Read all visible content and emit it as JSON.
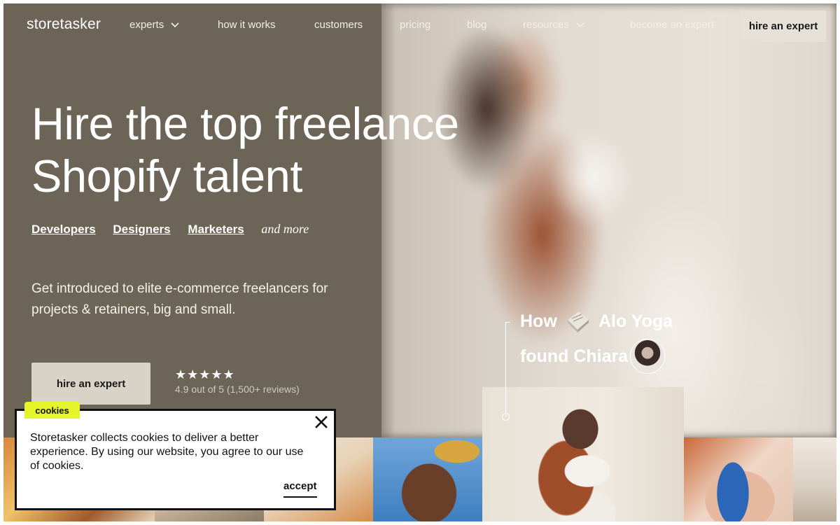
{
  "nav": {
    "logo": "storetasker",
    "items": [
      {
        "label": "experts",
        "has_dropdown": true
      },
      {
        "label": "how it works",
        "has_dropdown": false
      },
      {
        "label": "customers",
        "has_dropdown": false
      },
      {
        "label": "pricing",
        "has_dropdown": false
      },
      {
        "label": "blog",
        "has_dropdown": false
      },
      {
        "label": "resources",
        "has_dropdown": true
      },
      {
        "label": "become an expert",
        "has_dropdown": false
      }
    ],
    "cta": "hire an expert"
  },
  "hero": {
    "headline_line1": "Hire the top freelance",
    "headline_line2": "Shopify talent",
    "skills": [
      "Developers",
      "Designers",
      "Marketers"
    ],
    "and_more": "and more",
    "subcopy": "Get introduced to elite e-commerce freelancers for projects & retainers, big and small.",
    "cta": "hire an expert",
    "stars": "★★★★★",
    "rating_value": 4.9,
    "rating_text": "4.9 out of 5 (1,500+ reviews)"
  },
  "story": {
    "how": "How",
    "brand": "Alo Yoga",
    "brand_icon": "alo-yoga-logo-icon",
    "found": "found Chiara",
    "avatar": "chiara-avatar"
  },
  "cookie": {
    "tag": "cookies",
    "text": "Storetasker collects cookies to deliver a better experience. By using our website, you agree to our use of cookies.",
    "accept": "accept",
    "close_icon": "close-icon",
    "tag_color": "#e6f52b"
  },
  "colors": {
    "hero_bg": "#6b6457",
    "cta_bg": "#d8d2c7",
    "nav_cta_bg": "#e5e0d8"
  }
}
